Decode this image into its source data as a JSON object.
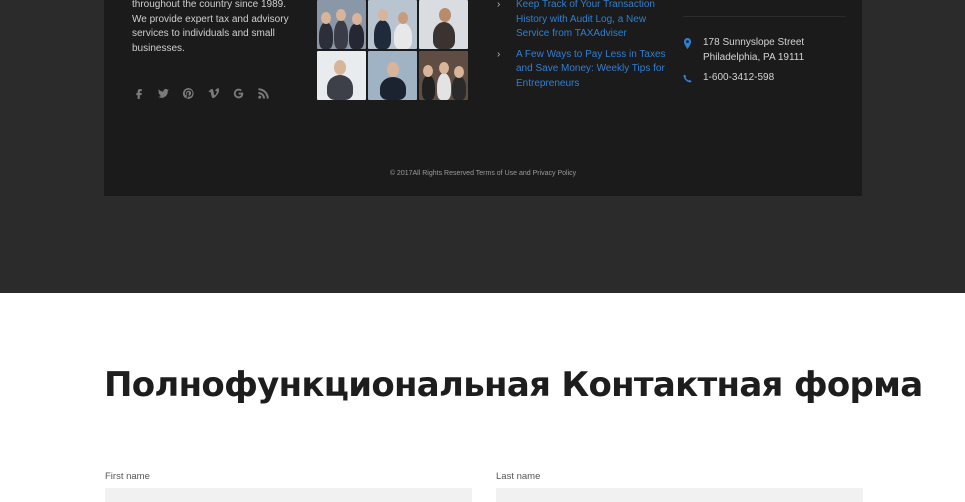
{
  "footer": {
    "about_text": "throughout the country since 1989. We provide expert tax and advisory services to individuals and small businesses.",
    "social_icons": [
      "facebook-icon",
      "twitter-icon",
      "pinterest-icon",
      "vimeo-icon",
      "google-icon",
      "rss-icon"
    ],
    "posts": [
      {
        "title": "Keep Track of Your Transaction History with Audit Log, a New Service from TAXAdviser"
      },
      {
        "title": "A Few Ways to Pay Less in Taxes and Save Money: Weekly Tips for Entrepreneurs"
      }
    ],
    "contact": {
      "address": "178 Sunnyslope Street Philadelphia, PA 19111",
      "phone": "1-600-3412-598"
    },
    "copyright": "© 2017All Rights Reserved Terms of Use and Privacy Policy",
    "colors": {
      "link": "#2f7fd4",
      "panel": "#1b1b1b",
      "band": "#2b2b2b"
    }
  },
  "form": {
    "title": "Полнофункциональная Контактная форма",
    "first_name_label": "First name",
    "last_name_label": "Last name",
    "first_name_value": "",
    "last_name_value": ""
  }
}
